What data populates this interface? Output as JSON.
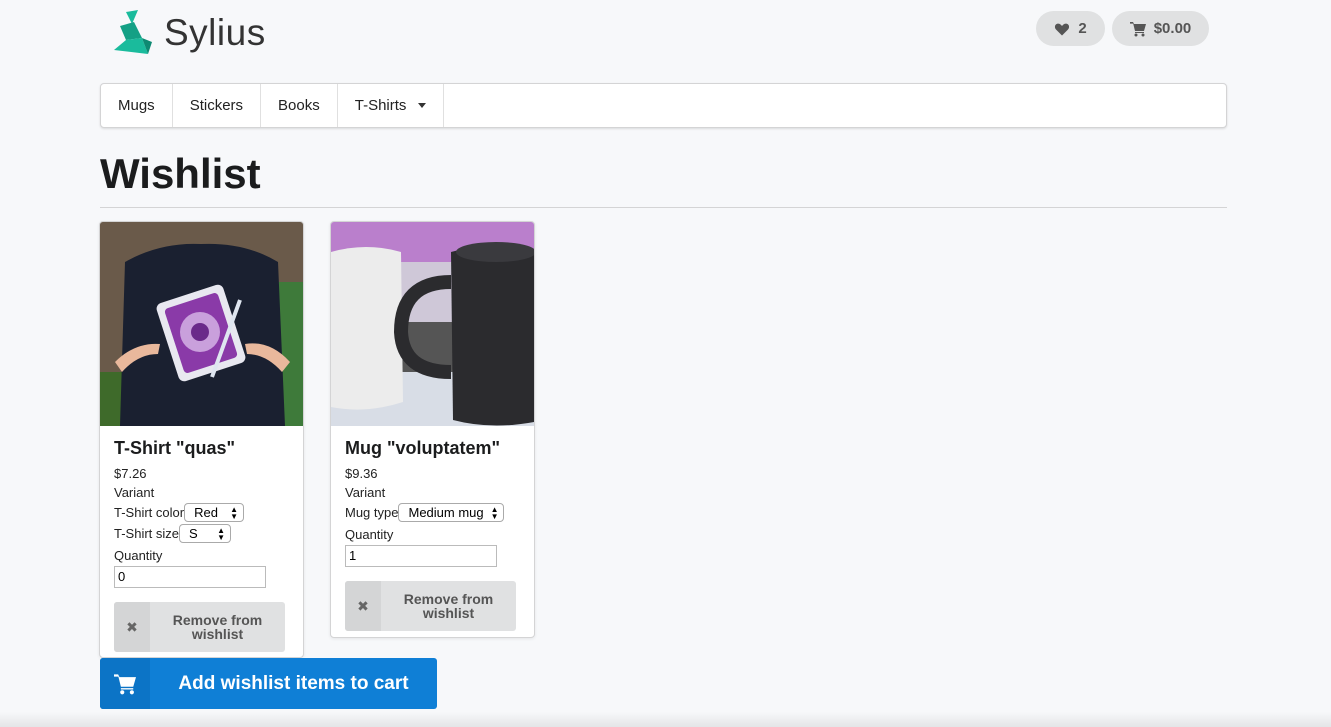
{
  "brand": {
    "name": "Sylius"
  },
  "header": {
    "wishlist_count": "2",
    "cart_total": "$0.00"
  },
  "nav": {
    "items": [
      {
        "label": "Mugs"
      },
      {
        "label": "Stickers"
      },
      {
        "label": "Books"
      },
      {
        "label": "T-Shirts"
      }
    ]
  },
  "page": {
    "title": "Wishlist"
  },
  "wishlist": {
    "items": [
      {
        "name": "T-Shirt \"quas\"",
        "price": "$7.26",
        "variant_label": "Variant",
        "options": [
          {
            "label": "T-Shirt color",
            "value": "Red"
          },
          {
            "label": "T-Shirt size",
            "value": "S"
          }
        ],
        "quantity_label": "Quantity",
        "quantity": "0",
        "remove_label": "Remove from wishlist"
      },
      {
        "name": "Mug \"voluptatem\"",
        "price": "$9.36",
        "variant_label": "Variant",
        "options": [
          {
            "label": "Mug type",
            "value": "Medium mug"
          }
        ],
        "quantity_label": "Quantity",
        "quantity": "1",
        "remove_label": "Remove from wishlist"
      }
    ],
    "add_all_label": "Add wishlist items to cart"
  },
  "colors": {
    "primary_button": "#0f7fd6",
    "brand_green": "#1abb9c"
  }
}
